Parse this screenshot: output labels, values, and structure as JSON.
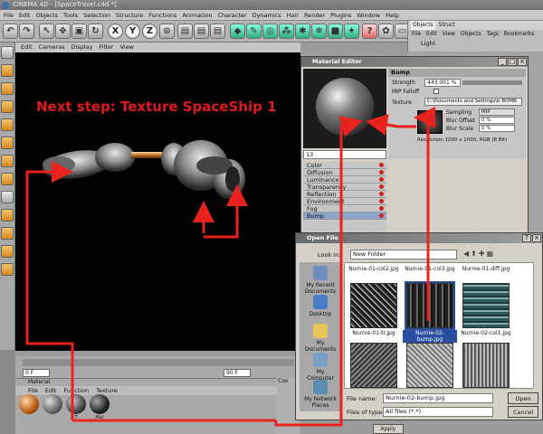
{
  "app": {
    "title": "CINEMA 4D - [SpaceTravel.c4d *]"
  },
  "menu": [
    "File",
    "Edit",
    "Objects",
    "Tools",
    "Selection",
    "Structure",
    "Functions",
    "Animation",
    "Character",
    "Dynamics",
    "Hair",
    "Render",
    "Plugins",
    "Window",
    "Help"
  ],
  "toolbar": {
    "x_label": "X",
    "y_label": "Y",
    "z_label": "Z"
  },
  "viewport": {
    "menu": [
      "Edit",
      "Cameras",
      "Display",
      "Filter",
      "View"
    ],
    "annotation": "Next step: Texture SpaceShip 1"
  },
  "timeline": {
    "start": "0 F",
    "end": "90 F"
  },
  "material_manager": {
    "title": "Material",
    "menu": [
      "File",
      "Edit",
      "Function",
      "Texture"
    ],
    "names": [
      "",
      "",
      "T",
      "Mat"
    ]
  },
  "object_manager": {
    "tab": "Objects",
    "tab2": "Struct",
    "menu": [
      "File",
      "Edit",
      "View",
      "Objects",
      "Tags",
      "Bookmarks"
    ],
    "item": "Light"
  },
  "material_editor": {
    "title": "Material Editor",
    "section": "Bump",
    "strength_label": "Strength",
    "strength_value": "443.001 %",
    "mip_falloff": "MIP Falloff",
    "texture_label": "Texture",
    "texture_path": "C:\\Documents and Settings\\b BOMB",
    "sampling_label": "Sampling",
    "sampling_value": "MIP",
    "blur_offset_label": "Blur Offset",
    "blur_offset_value": "0 %",
    "blur_scale_label": "Blur Scale",
    "blur_scale_value": "0 %",
    "resolution": "Resolution 1000 x 1000, RGB (8 Bit)",
    "name_field": "13",
    "channels": [
      "Color",
      "Diffusion",
      "Luminance",
      "Transparency",
      "Reflection",
      "Environment",
      "Fog",
      "Bump"
    ]
  },
  "open_file": {
    "title": "Open File",
    "look_in_label": "Look in:",
    "look_in_value": "New Folder",
    "places": [
      "My Recent Documents",
      "Desktop",
      "My Documents",
      "My Computer",
      "My Network Places"
    ],
    "files": [
      "Nurnie-01-col2.jpg",
      "Nurnie-01-col3.jpg",
      "Nurnie-01-diff.jpg",
      "Nurnie-01-tr.jpg",
      "Nurnie-02-bump.jpg",
      "Nurnie-02-col1.jpg",
      "",
      "",
      ""
    ],
    "file_name_label": "File name:",
    "file_name_value": "Nurnie-02-bump.jpg",
    "file_type_label": "Files of type:",
    "file_type_value": "All files (*.*)",
    "open_label": "Open",
    "cancel_label": "Cancel"
  },
  "coords": {
    "apply_label": "Apply",
    "title": "Coo"
  },
  "colors": {
    "annotation": "#e01a1a",
    "arrow": "#e8231f"
  }
}
